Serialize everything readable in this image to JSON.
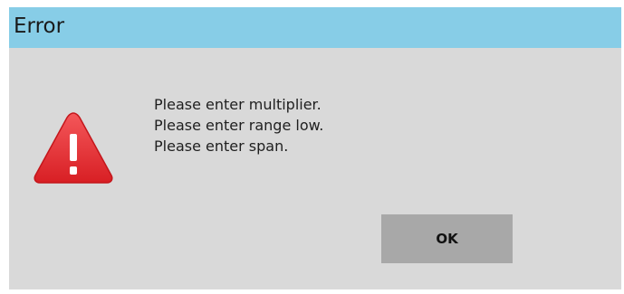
{
  "dialog": {
    "title": "Error",
    "icon": "warning-triangle-icon",
    "messages": [
      "Please enter multiplier.",
      "Please enter range low.",
      "Please enter span."
    ],
    "ok_label": "OK"
  },
  "colors": {
    "titlebar": "#87cde7",
    "body": "#d9d9d9",
    "button": "#a8a8a8",
    "warning_red": "#e8262a"
  }
}
